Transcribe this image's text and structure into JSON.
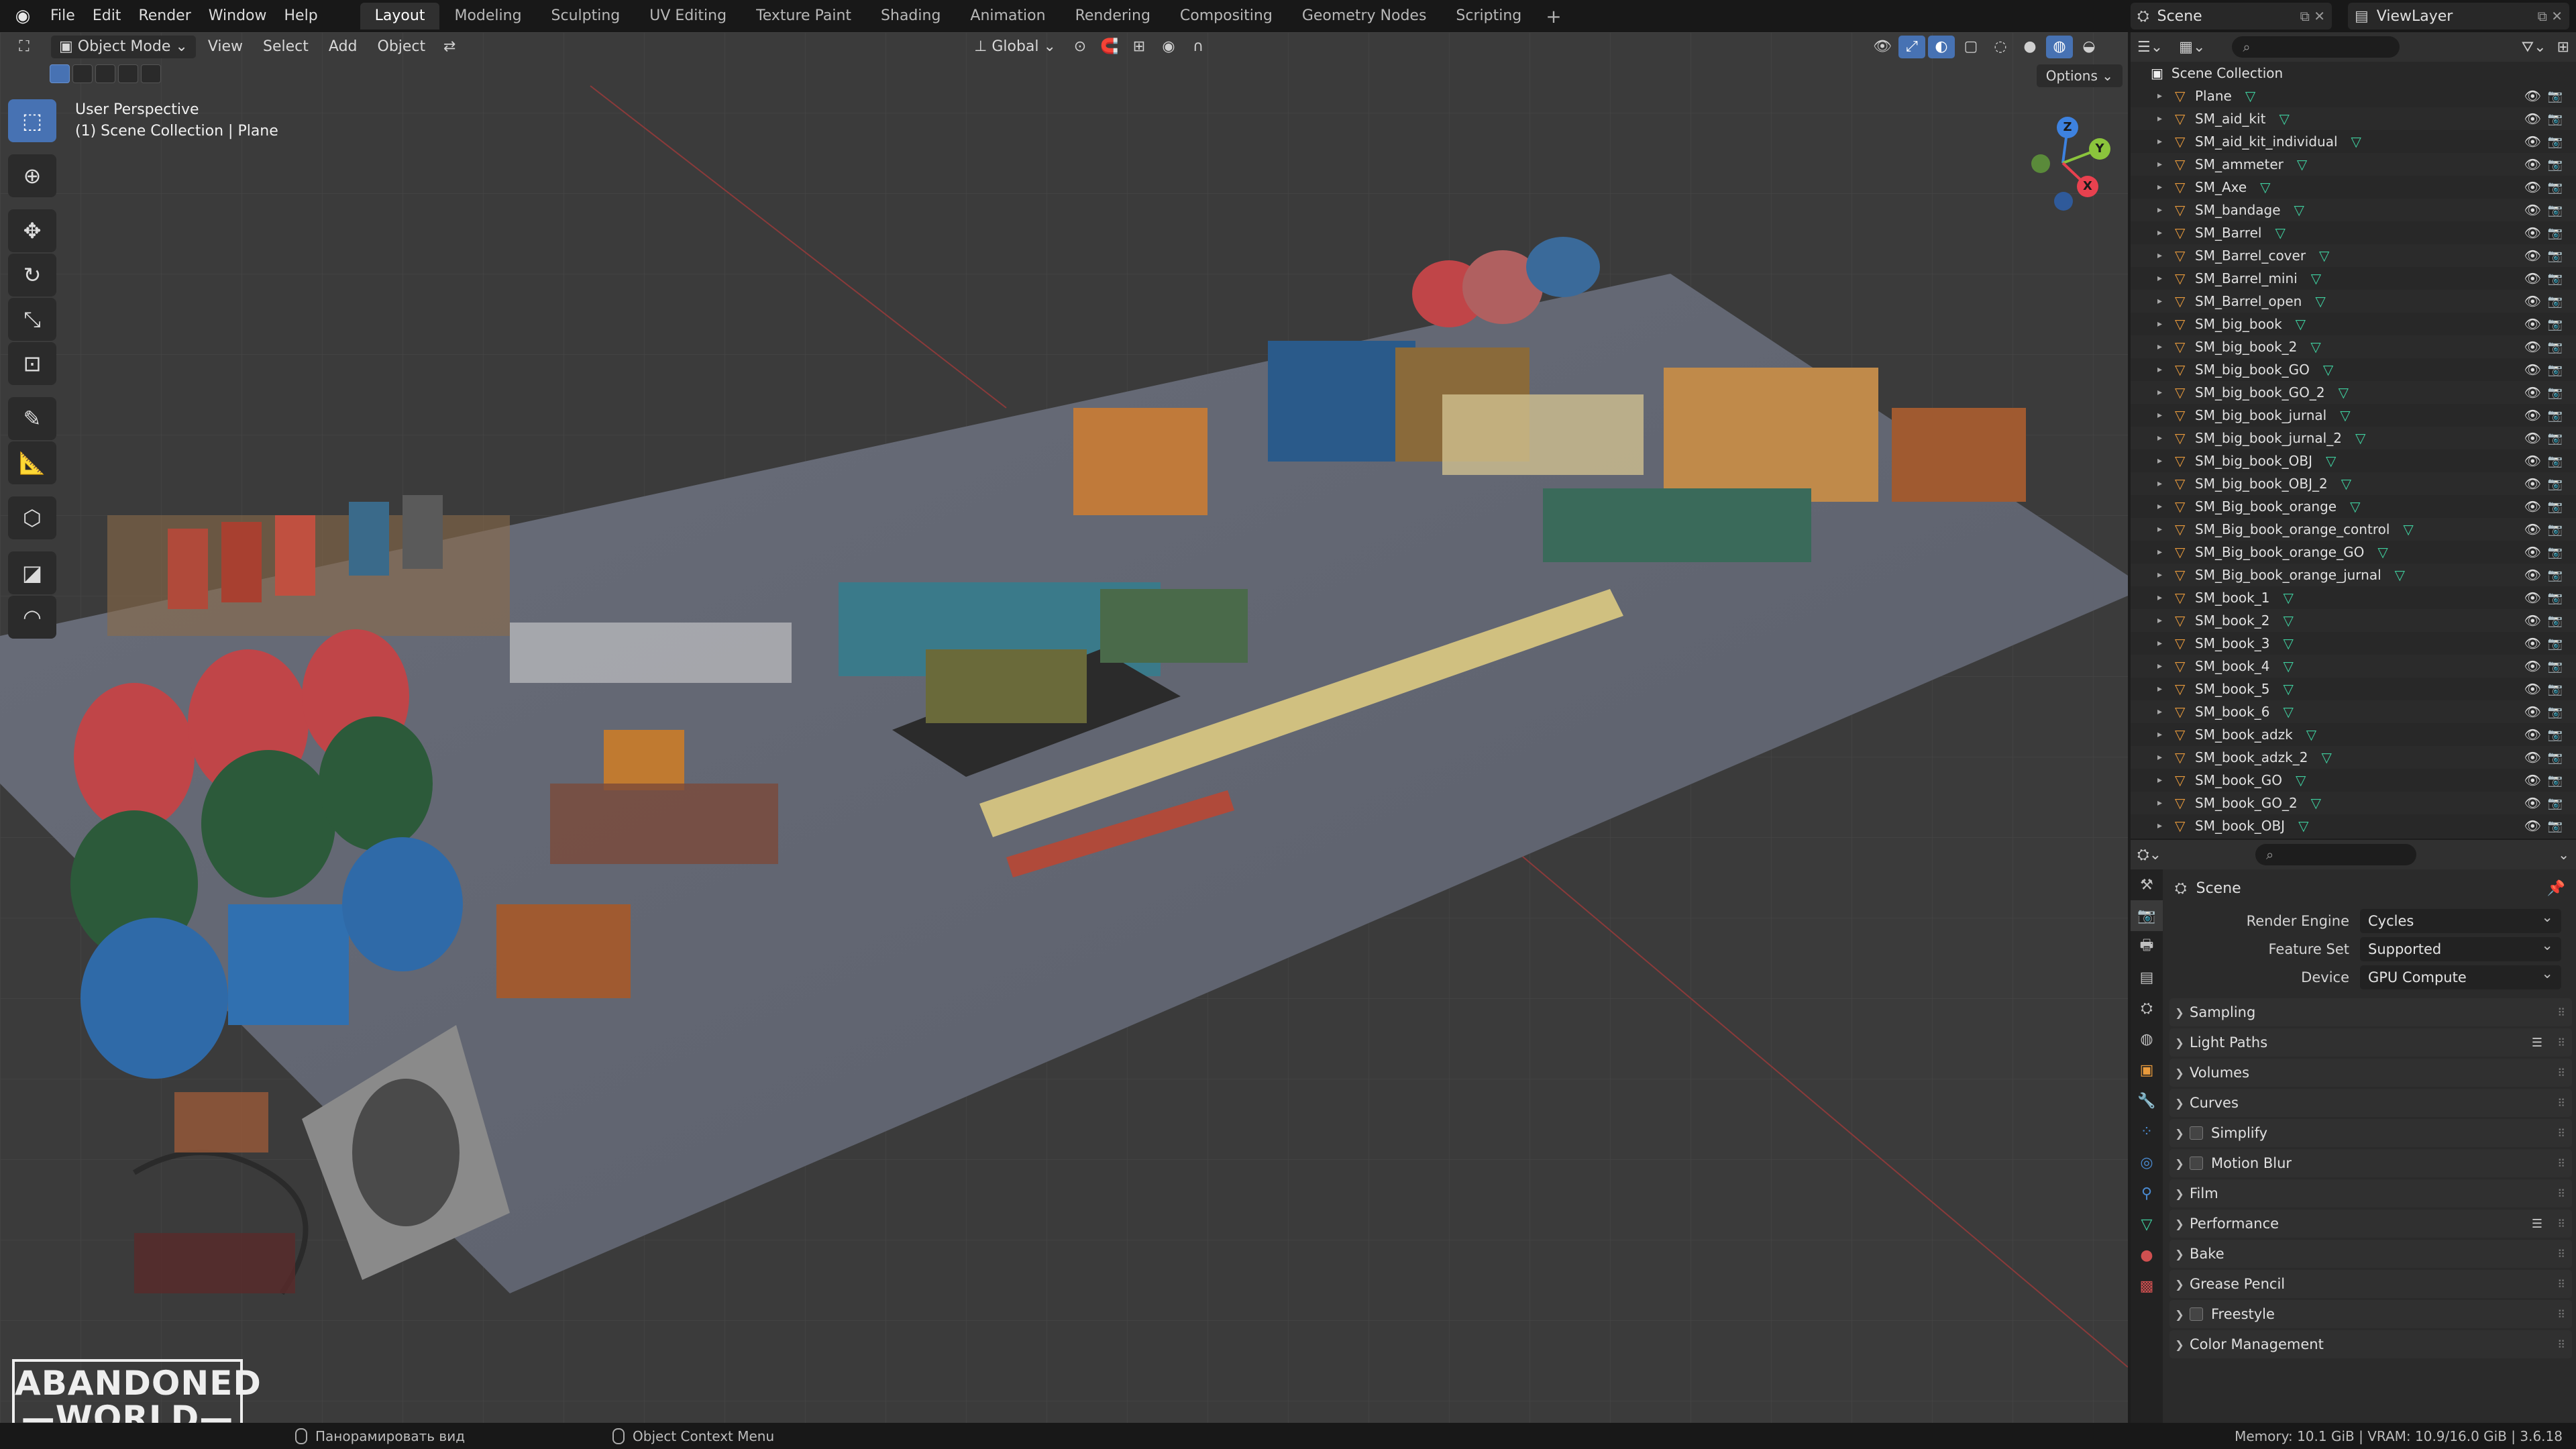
{
  "menu": [
    "File",
    "Edit",
    "Render",
    "Window",
    "Help"
  ],
  "workspaces": [
    {
      "label": "Layout",
      "active": true
    },
    {
      "label": "Modeling"
    },
    {
      "label": "Sculpting"
    },
    {
      "label": "UV Editing"
    },
    {
      "label": "Texture Paint"
    },
    {
      "label": "Shading"
    },
    {
      "label": "Animation"
    },
    {
      "label": "Rendering"
    },
    {
      "label": "Compositing"
    },
    {
      "label": "Geometry Nodes"
    },
    {
      "label": "Scripting"
    }
  ],
  "scene_name": "Scene",
  "view_layer": "ViewLayer",
  "viewport": {
    "mode": "Object Mode",
    "menus": [
      "View",
      "Select",
      "Add",
      "Object"
    ],
    "transform_orientation": "Global",
    "options_label": "Options",
    "perspective_label": "User Perspective",
    "context_label": "(1) Scene Collection | Plane",
    "gizmo": {
      "x": "X",
      "y": "Y",
      "z": "Z"
    }
  },
  "watermark": {
    "line1": "ABANDONED",
    "line2": "WORLD"
  },
  "outliner": {
    "root": "Scene Collection",
    "items": [
      "Plane",
      "SM_aid_kit",
      "SM_aid_kit_individual",
      "SM_ammeter",
      "SM_Axe",
      "SM_bandage",
      "SM_Barrel",
      "SM_Barrel_cover",
      "SM_Barrel_mini",
      "SM_Barrel_open",
      "SM_big_book",
      "SM_big_book_2",
      "SM_big_book_GO",
      "SM_big_book_GO_2",
      "SM_big_book_jurnal",
      "SM_big_book_jurnal_2",
      "SM_big_book_OBJ",
      "SM_big_book_OBJ_2",
      "SM_Big_book_orange",
      "SM_Big_book_orange_control",
      "SM_Big_book_orange_GO",
      "SM_Big_book_orange_jurnal",
      "SM_book_1",
      "SM_book_2",
      "SM_book_3",
      "SM_book_4",
      "SM_book_5",
      "SM_book_6",
      "SM_book_adzk",
      "SM_book_adzk_2",
      "SM_book_GO",
      "SM_book_GO_2",
      "SM_book_OBJ"
    ]
  },
  "properties": {
    "scene_label": "Scene",
    "render_engine_label": "Render Engine",
    "render_engine": "Cycles",
    "feature_set_label": "Feature Set",
    "feature_set": "Supported",
    "device_label": "Device",
    "device": "GPU Compute",
    "panels": [
      {
        "label": "Sampling"
      },
      {
        "label": "Light Paths",
        "list": true
      },
      {
        "label": "Volumes"
      },
      {
        "label": "Curves"
      },
      {
        "label": "Simplify",
        "check": true
      },
      {
        "label": "Motion Blur",
        "check": true
      },
      {
        "label": "Film"
      },
      {
        "label": "Performance",
        "list": true
      },
      {
        "label": "Bake"
      },
      {
        "label": "Grease Pencil"
      },
      {
        "label": "Freestyle",
        "check": true
      },
      {
        "label": "Color Management"
      }
    ]
  },
  "status": {
    "pan_hint": "Панорамировать вид",
    "context_menu_hint": "Object Context Menu",
    "stats": "Memory: 10.1 GiB | VRAM: 10.9/16.0 GiB | 3.6.18"
  },
  "colors": {
    "accent": "#4772b3",
    "object_icon": "#e89a3c",
    "mesh_icon": "#3fcf9f",
    "axis_x": "#e8414f",
    "axis_y": "#8bc43c",
    "axis_z": "#3d82e0"
  }
}
